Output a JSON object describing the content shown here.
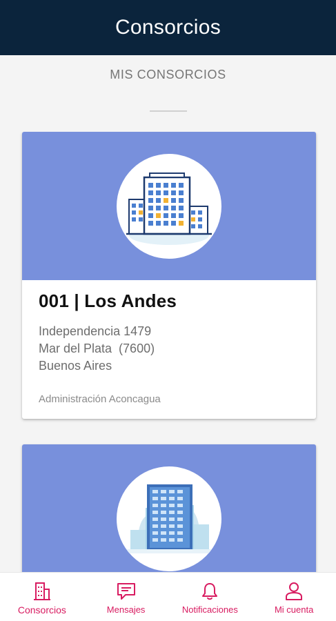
{
  "header": {
    "title": "Consorcios"
  },
  "section": {
    "title": "MIS CONSORCIOS"
  },
  "colors": {
    "header_bg": "#0b243c",
    "card_banner": "#7890dc",
    "accent": "#d81b60"
  },
  "cards": [
    {
      "title": "001 | Los Andes",
      "address_line1": "Independencia 1479",
      "address_line2": "Mar del Plata  (7600)",
      "address_line3": "Buenos Aires",
      "admin": "Administración Aconcagua",
      "icon": "buildings-icon"
    },
    {
      "icon": "tower-building-icon"
    }
  ],
  "bottom_nav": {
    "items": [
      {
        "label": "Consorcios",
        "icon": "building-icon",
        "active": true
      },
      {
        "label": "Mensajes",
        "icon": "message-icon",
        "active": false
      },
      {
        "label": "Notificaciones",
        "icon": "bell-icon",
        "active": false
      },
      {
        "label": "Mi cuenta",
        "icon": "user-icon",
        "active": false
      }
    ]
  }
}
